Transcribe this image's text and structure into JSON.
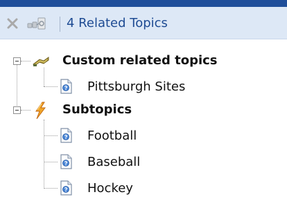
{
  "toolbar": {
    "close_icon": "close-x-icon",
    "link_icon": "link-topics-icon",
    "title": "4 Related Topics"
  },
  "tree": {
    "custom": {
      "label": "Custom related topics",
      "icon": "custom-topics-icon",
      "children": [
        {
          "label": "Pittsburgh Sites",
          "icon": "topic-page-icon"
        }
      ]
    },
    "subtopics": {
      "label": "Subtopics",
      "icon": "lightning-icon",
      "children": [
        {
          "label": "Football",
          "icon": "topic-page-icon"
        },
        {
          "label": "Baseball",
          "icon": "topic-page-icon"
        },
        {
          "label": "Hockey",
          "icon": "topic-page-icon"
        }
      ]
    }
  },
  "colors": {
    "title_text": "#1e4b93",
    "toolbar_bg": "#dde8f6",
    "top_bar": "#1f4e9a"
  }
}
